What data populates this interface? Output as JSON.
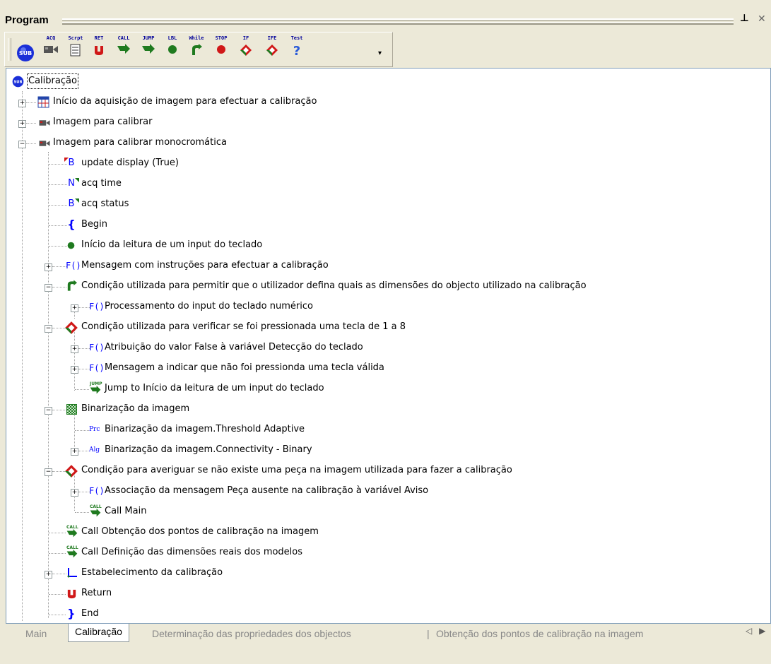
{
  "panel": {
    "title": "Program",
    "pin_icon": "pin-icon",
    "close_icon": "close-icon"
  },
  "toolbar": {
    "buttons": [
      {
        "label": "",
        "icon": "sub-icon"
      },
      {
        "label": "ACQ",
        "icon": "camera-icon"
      },
      {
        "label": "Scrpt",
        "icon": "script-icon"
      },
      {
        "label": "RET",
        "icon": "return-icon"
      },
      {
        "label": "CALL",
        "icon": "call-icon"
      },
      {
        "label": "JUMP",
        "icon": "jump-icon"
      },
      {
        "label": "LBL",
        "icon": "label-icon"
      },
      {
        "label": "While",
        "icon": "while-icon"
      },
      {
        "label": "STOP",
        "icon": "stop-icon"
      },
      {
        "label": "IF",
        "icon": "if-icon"
      },
      {
        "label": "IFE",
        "icon": "ife-icon"
      },
      {
        "label": "Test",
        "icon": "test-icon"
      }
    ]
  },
  "tree": {
    "items": [
      {
        "text": "Calibração",
        "icon": "sub-icon"
      },
      {
        "text": "Início da aquisição de imagem para efectuar a calibração",
        "icon": "table-icon"
      },
      {
        "text": "Imagem para calibrar",
        "icon": "camera-icon"
      },
      {
        "text": "Imagem para calibrar monocromática",
        "icon": "camera-icon"
      },
      {
        "text": "update display (True)",
        "icon": "bool-icon",
        "glyph": "B"
      },
      {
        "text": "acq time",
        "icon": "number-icon",
        "glyph": "N"
      },
      {
        "text": "acq status",
        "icon": "bool-icon",
        "glyph": "B"
      },
      {
        "text": "Begin",
        "icon": "begin-brace-icon",
        "glyph": "{"
      },
      {
        "text": "Início da leitura de um input do teclado",
        "icon": "label-dot-icon"
      },
      {
        "text": "Mensagem com instruções para efectuar a calibração",
        "icon": "function-icon",
        "glyph": "F()"
      },
      {
        "text": "Condição utilizada para permitir que o utilizador defina quais as dimensões do objecto utilizado na calibração",
        "icon": "while-icon"
      },
      {
        "text": "Processamento do input do teclado numérico",
        "icon": "function-icon",
        "glyph": "F()"
      },
      {
        "text": "Condição utilizada para verificar se foi pressionada uma tecla de 1 a 8",
        "icon": "if-diamond-icon"
      },
      {
        "text": "Atribuição do valor False à variável Detecção do teclado",
        "icon": "function-icon",
        "glyph": "F()"
      },
      {
        "text": "Mensagem a indicar que não foi pressionda uma tecla válida",
        "icon": "function-icon",
        "glyph": "F()"
      },
      {
        "text": "Jump to Início da leitura de um input do teclado",
        "icon": "jump-icon",
        "tag": "JUMP"
      },
      {
        "text": "Binarização da imagem",
        "icon": "binarize-icon"
      },
      {
        "text": "Binarização da imagem.Threshold Adaptive",
        "icon": "process-icon",
        "glyph": "Prc"
      },
      {
        "text": "Binarização da imagem.Connectivity - Binary",
        "icon": "algorithm-icon",
        "glyph": "Alg"
      },
      {
        "text": "Condição para averiguar se não existe uma peça na imagem utilizada para fazer a calibração",
        "icon": "if-diamond-icon"
      },
      {
        "text": "Associação da mensagem Peça ausente na calibração à variável Aviso",
        "icon": "function-icon",
        "glyph": "F()"
      },
      {
        "text": "Call Main",
        "icon": "call-icon",
        "tag": "CALL"
      },
      {
        "text": "Call Obtenção dos pontos de calibração na imagem",
        "icon": "call-icon",
        "tag": "CALL"
      },
      {
        "text": "Call Definição das dimensões reais dos modelos",
        "icon": "call-icon",
        "tag": "CALL"
      },
      {
        "text": "Estabelecimento da calibração",
        "icon": "axes-icon"
      },
      {
        "text": "Return",
        "icon": "return-icon"
      },
      {
        "text": "End",
        "icon": "end-brace-icon",
        "glyph": "}"
      }
    ]
  },
  "tabs": [
    {
      "label": "Main"
    },
    {
      "label": "Calibração"
    },
    {
      "label": "Determinação das propriedades dos objectos"
    },
    {
      "label": "Obtenção dos pontos de calibração na imagem"
    }
  ],
  "tab_separator": "|",
  "tab_nav": {
    "prev": "◁",
    "next": "▶"
  },
  "colors": {
    "accent": "#00F",
    "green": "#2a8a2a",
    "red": "#d01818",
    "panel": "#ECE9D8"
  }
}
